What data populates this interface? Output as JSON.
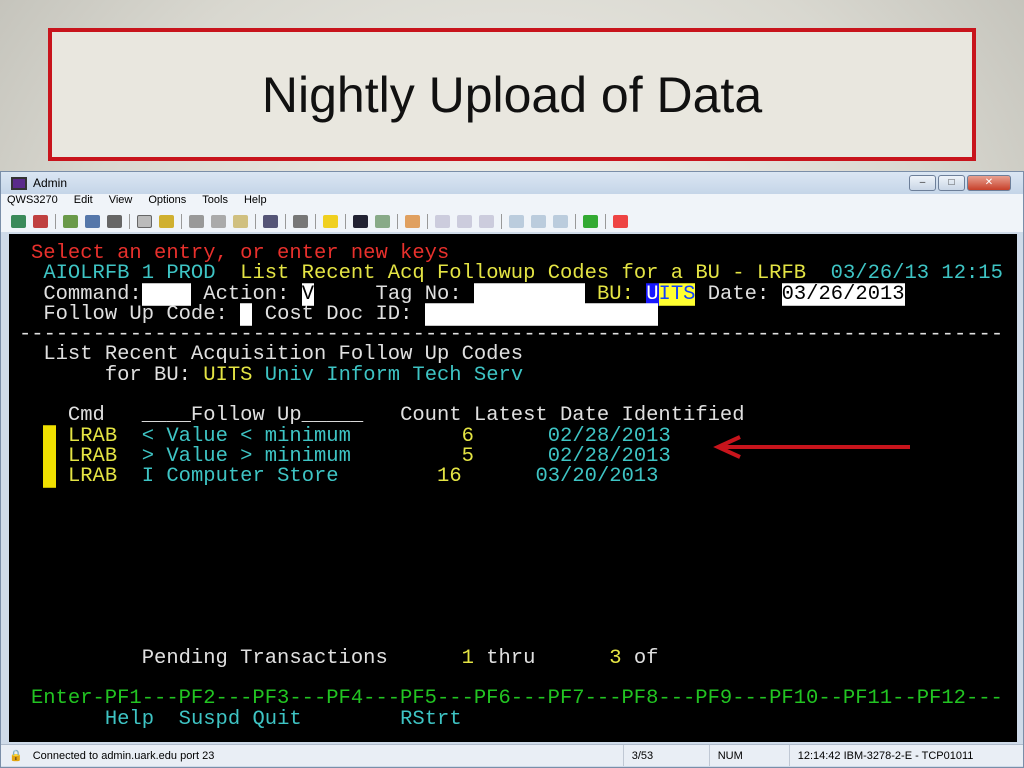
{
  "slide": {
    "title": "Nightly Upload of Data"
  },
  "window": {
    "title": "Admin",
    "menu": [
      "QWS3270",
      "Edit",
      "View",
      "Options",
      "Tools",
      "Help"
    ]
  },
  "terminal": {
    "message": "Select an entry, or enter new keys",
    "header_id": "AIOLRFB 1 PROD",
    "header_title": "List Recent Acq Followup Codes for a BU - LRFB",
    "header_datetime": "03/26/13 12:15",
    "command_label": "Command:",
    "command_value": "",
    "action_label": "Action:",
    "action_value": "V",
    "tag_label": "Tag No:",
    "tag_value": "",
    "bu_label": "BU:",
    "bu_value_first": "U",
    "bu_value_rest": "ITS",
    "date_label": "Date:",
    "date_value": "03/26/2013",
    "followup_label": "Follow Up Code:",
    "followup_value": "",
    "costdoc_label": "Cost Doc ID:",
    "costdoc_value": "",
    "divider": "--------------------------------------------------------------------------------",
    "list_title": "List Recent Acquisition Follow Up Codes",
    "for_bu_label": "for BU:",
    "for_bu_code": "UITS",
    "for_bu_name": "Univ Inform Tech Serv",
    "columns": {
      "cmd": "Cmd",
      "followup": "____Follow Up_____",
      "count": "Count",
      "latest": "Latest Date Identified"
    },
    "rows": [
      {
        "cmd": "LRAB",
        "followup": "< Value < minimum",
        "count": "6",
        "date": "02/28/2013"
      },
      {
        "cmd": "LRAB",
        "followup": "> Value > minimum",
        "count": "5",
        "date": "02/28/2013"
      },
      {
        "cmd": "LRAB",
        "followup": "I Computer Store",
        "count": "16",
        "date": "03/20/2013"
      }
    ],
    "pending_label": "Pending Transactions",
    "pending_from": "1",
    "pending_thru": "thru",
    "pending_to": "3",
    "pending_of": "of",
    "pf_line": "Enter-PF1---PF2---PF3---PF4---PF5---PF6---PF7---PF8---PF9---PF10--PF11--PF12---",
    "pf_labels": {
      "pf1": "Help",
      "pf2": "Suspd",
      "pf3": "Quit",
      "pf6": "RStrt"
    }
  },
  "status": {
    "connection": "Connected to admin.uark.edu port 23",
    "cursor": "3/53",
    "num": "NUM",
    "time_terminal": "12:14:42  IBM-3278-2-E - TCP01011"
  },
  "colors": {
    "accent_red": "#c8141c",
    "term_bg": "#000000"
  }
}
